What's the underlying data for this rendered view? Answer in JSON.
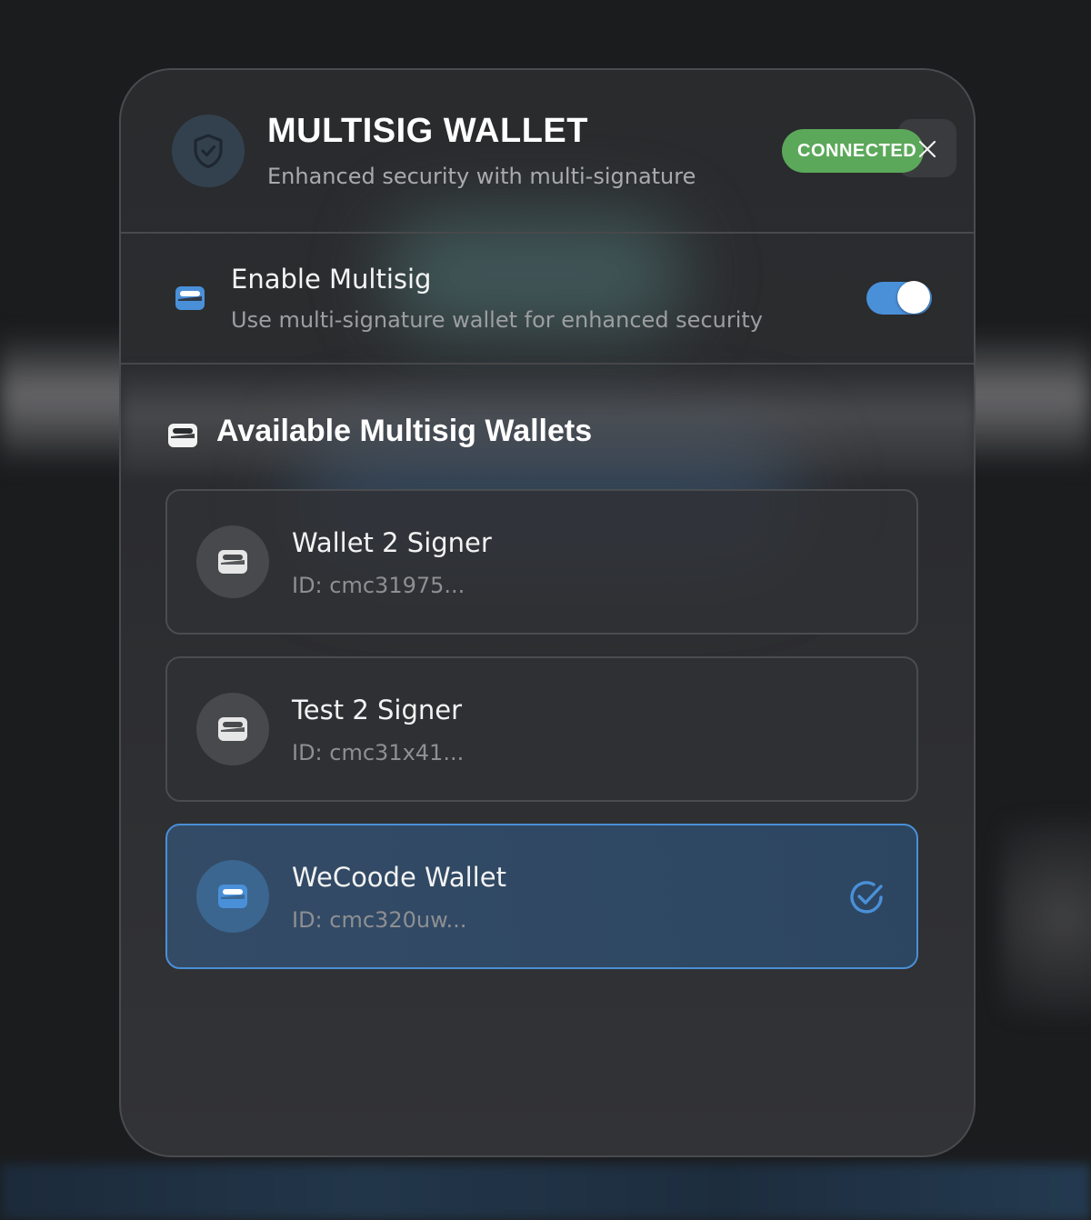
{
  "header": {
    "title": "MULTISIG WALLET",
    "subtitle": "Enhanced security with multi-signature",
    "status_badge": "CONNECTED"
  },
  "enable": {
    "title": "Enable Multisig",
    "description": "Use multi-signature wallet for enhanced security",
    "enabled": true
  },
  "section": {
    "title": "Available Multisig Wallets"
  },
  "wallets": [
    {
      "name": "Wallet 2 Signer",
      "id": "ID: cmc31975...",
      "selected": false
    },
    {
      "name": "Test 2 Signer",
      "id": "ID: cmc31x41...",
      "selected": false
    },
    {
      "name": "WeCoode Wallet",
      "id": "ID: cmc320uw...",
      "selected": true
    }
  ],
  "colors": {
    "accent": "#4a90d9",
    "success": "#5ba85a",
    "background": "#1b1c1e",
    "panel": "#2b2c2f"
  },
  "icons": {
    "header": "shield-check-icon",
    "close": "close-icon",
    "wallet": "wallet-icon",
    "selected": "check-circle-icon"
  }
}
